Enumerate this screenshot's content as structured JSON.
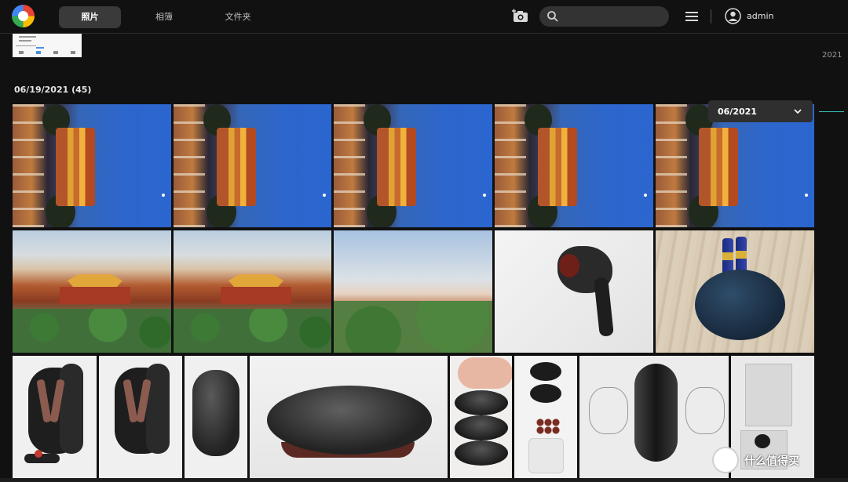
{
  "header": {
    "tabs": [
      {
        "label": "照片",
        "active": true
      },
      {
        "label": "相簿",
        "active": false
      },
      {
        "label": "文件夹",
        "active": false
      }
    ],
    "icons": [
      "logo-icon",
      "upload-photo-icon",
      "search-icon",
      "list-menu-icon",
      "avatar-icon"
    ],
    "search": {
      "placeholder": "",
      "value": ""
    },
    "user": {
      "name": "admin"
    }
  },
  "timeline": {
    "year": "2021"
  },
  "section": {
    "date_header": "06/19/2021 (45)"
  },
  "month_selector": {
    "selected": "06/2021"
  },
  "watermark": {
    "text": "什么值得买"
  },
  "colors": {
    "background": "#111111",
    "active_tab": "#3a3a3a",
    "accent": "#34c1b8"
  }
}
